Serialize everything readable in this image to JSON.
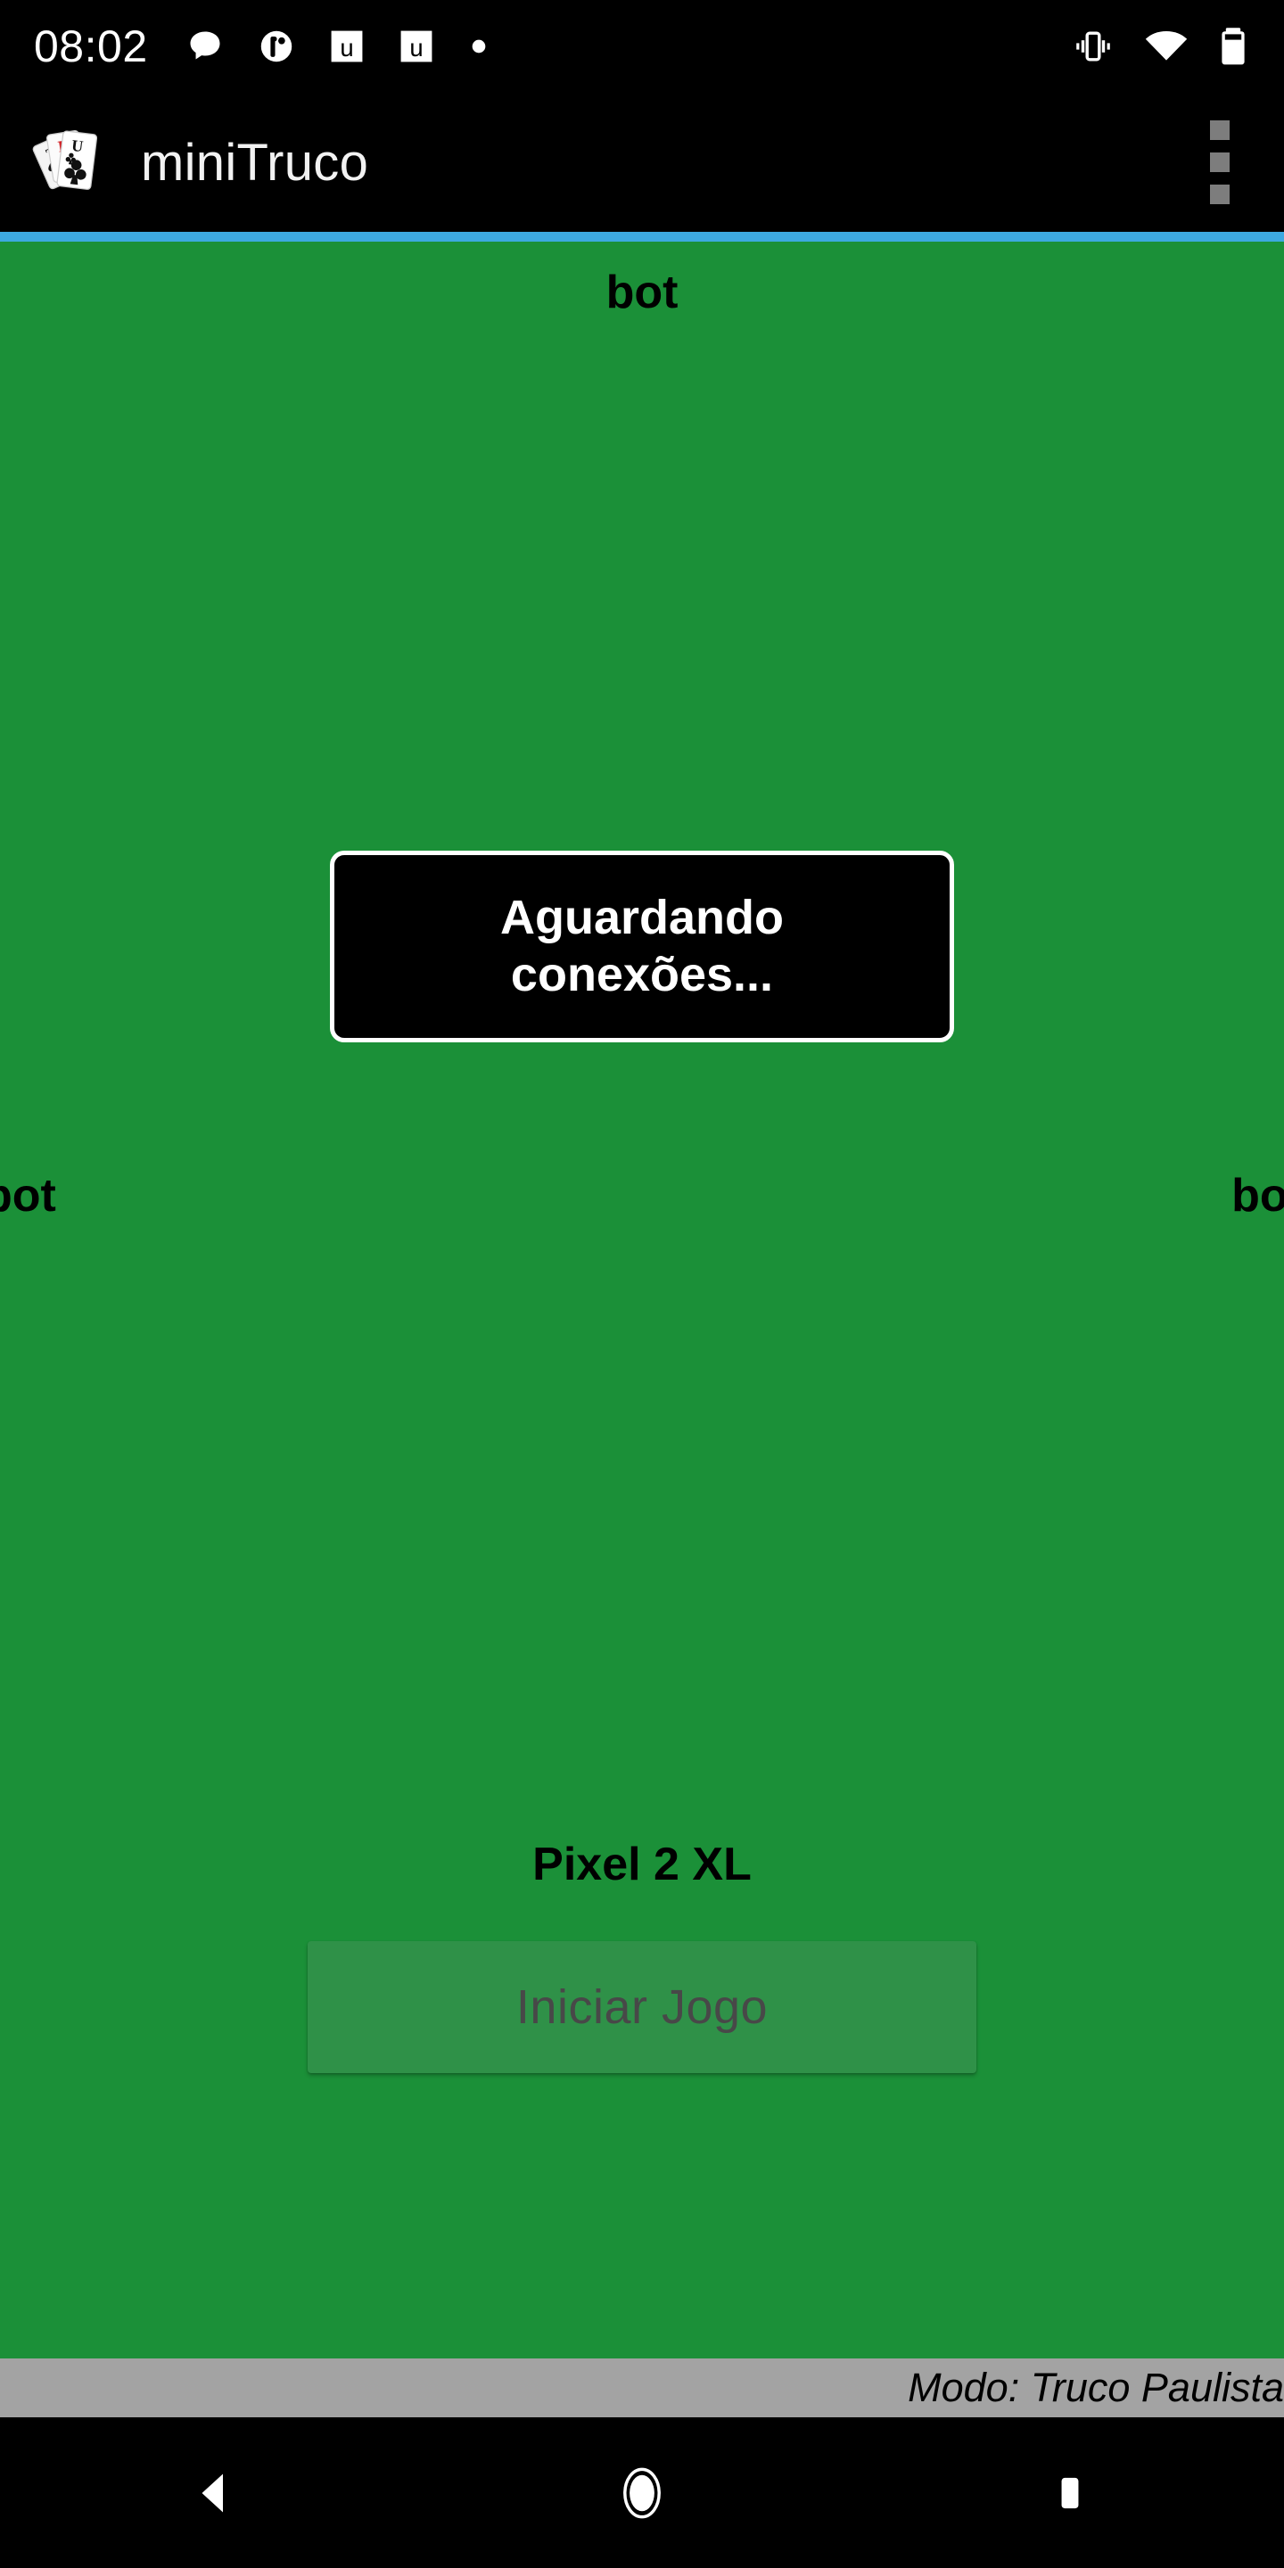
{
  "status_bar": {
    "clock": "08:02",
    "notification_icons": [
      "chat-bubble-icon",
      "circle-glyph-icon",
      "u-badge-icon",
      "u-badge-icon",
      "dot-icon"
    ],
    "system_icons": [
      "vibrate-icon",
      "wifi-icon",
      "battery-icon"
    ]
  },
  "app_bar": {
    "title": "miniTruco",
    "logo_icon": "truco-cards-logo-icon",
    "logo_card_letters": [
      "T",
      "R",
      "U"
    ],
    "overflow_icon": "overflow-menu-icon",
    "background_color": "#000000",
    "title_color": "#f2f2f2",
    "accent_color": "#3da9e0"
  },
  "table": {
    "background_color": "#1b9038",
    "players": {
      "top": "bot",
      "left": "bot",
      "right": "bot",
      "bottom": "Pixel 2 XL"
    }
  },
  "dialog": {
    "message": "Aguardando conexões...",
    "background_color": "#000000",
    "border_color": "#ffffff",
    "text_color": "#ffffff"
  },
  "start_button": {
    "label": "Iniciar Jogo",
    "enabled": "false",
    "fill_color": "#2f9148",
    "text_color": "#484848"
  },
  "mode_bar": {
    "text": "Modo: Truco Paulista",
    "background_color": "#a3a3a3",
    "text_color": "#000000"
  },
  "nav_bar": {
    "back_icon": "back-triangle-icon",
    "home_icon": "home-circle-icon",
    "recents_icon": "recents-square-icon"
  }
}
